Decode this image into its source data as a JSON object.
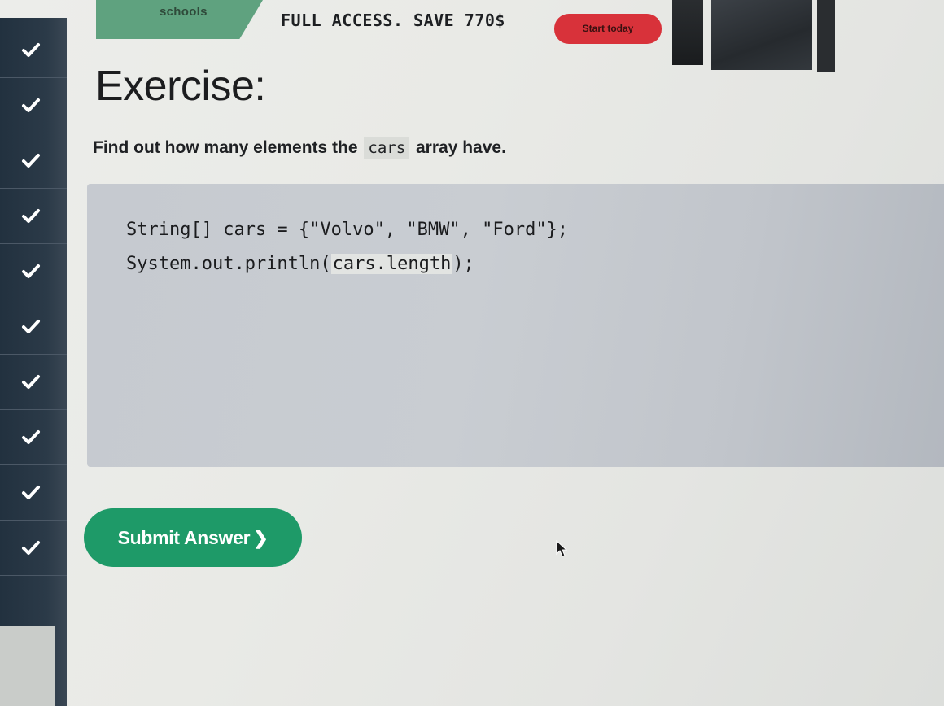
{
  "banner": {
    "logo_text": "schools",
    "headline": "FULL ACCESS. SAVE 770$",
    "cta_label": "Start today",
    "cta_color": "#d8323a"
  },
  "sidebar": {
    "items": [
      {
        "icon": "checkmark-icon",
        "state": "completed"
      },
      {
        "icon": "checkmark-icon",
        "state": "completed"
      },
      {
        "icon": "checkmark-icon",
        "state": "completed"
      },
      {
        "icon": "checkmark-icon",
        "state": "completed"
      },
      {
        "icon": "checkmark-icon",
        "state": "completed"
      },
      {
        "icon": "checkmark-icon",
        "state": "completed"
      },
      {
        "icon": "checkmark-icon",
        "state": "completed"
      },
      {
        "icon": "checkmark-icon",
        "state": "completed"
      },
      {
        "icon": "checkmark-icon",
        "state": "completed"
      },
      {
        "icon": "checkmark-icon",
        "state": "completed"
      }
    ]
  },
  "exercise": {
    "title": "Exercise:",
    "prompt_before": "Find out how many elements the",
    "prompt_code": "cars",
    "prompt_after": "array have.",
    "code_line_1": "String[] cars = {\"Volvo\", \"BMW\", \"Ford\"};",
    "code_line_2_prefix": "System.out.println(",
    "answer_value": "cars.length",
    "code_line_2_suffix": ");"
  },
  "submit": {
    "label": "Submit Answer",
    "chevron": "❯",
    "color": "#1e9a68"
  },
  "colors": {
    "sidebar_bg": "#22313f",
    "checkmark": "#ffffff",
    "code_bg": "#c6cad0"
  }
}
